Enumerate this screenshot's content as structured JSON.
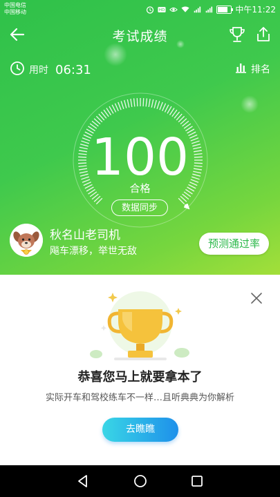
{
  "statusbar": {
    "carrier1": "中国电信",
    "carrier2": "中国移动",
    "time": "中午11:22",
    "battery_level": 0.85,
    "icons": [
      "alarm-icon",
      "hd-icon",
      "eye-icon",
      "wifi-icon",
      "signal-3g-icon",
      "signal-4g-icon",
      "battery-icon"
    ]
  },
  "header": {
    "title": "考试成绩"
  },
  "summary": {
    "time_label": "用时",
    "time_value": "06:31",
    "rank_label": "排名"
  },
  "result": {
    "score": "100",
    "status": "合格",
    "sync_label": "数据同步",
    "score_fraction": 1.0
  },
  "user": {
    "name": "秋名山老司机",
    "motto": "飚车漂移，举世无敌",
    "predict_label": "预测通过率"
  },
  "panel": {
    "congrats": "恭喜您马上就要拿本了",
    "subtext": "实际开车和驾校练车不一样…且听典典为你解析",
    "button_label": "去瞧瞧"
  },
  "colors": {
    "green_start": "#2fc14a",
    "green_end": "#a3df3a",
    "button_start": "#39d6e6",
    "button_end": "#1e90ea",
    "trophy": "#f5c23c"
  }
}
